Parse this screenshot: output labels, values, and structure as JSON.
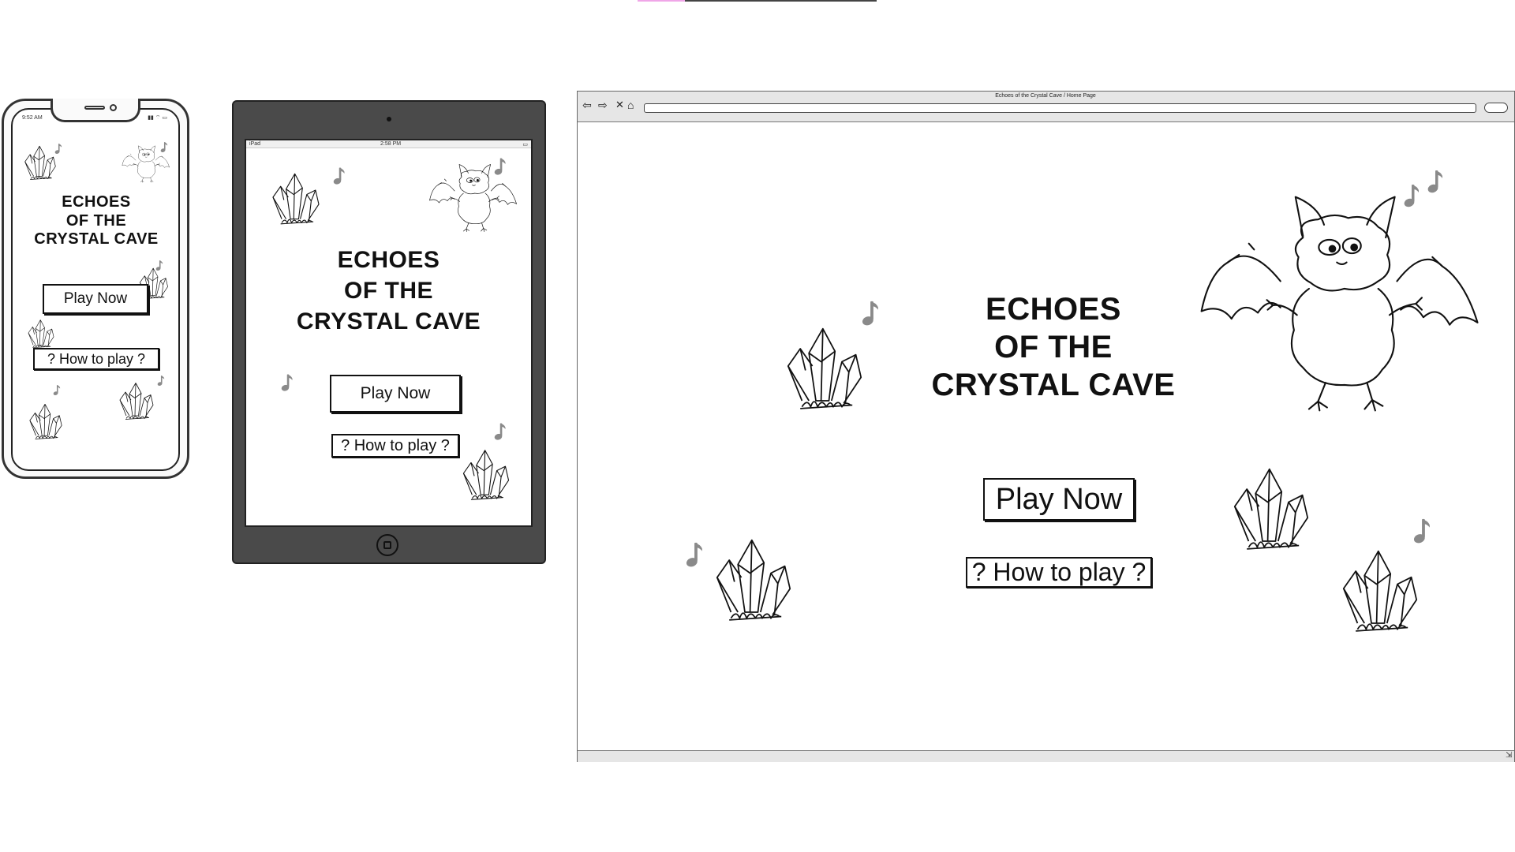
{
  "phone": {
    "status_time": "9:52 AM",
    "title_lines": [
      "ECHOES",
      "OF THE",
      "CRYSTAL CAVE"
    ],
    "play_label": "Play Now",
    "help_label": "? How to play ?"
  },
  "tablet": {
    "status_carrier": "iPad",
    "status_time": "2:58 PM",
    "title_lines": [
      "ECHOES",
      "OF THE",
      "CRYSTAL CAVE"
    ],
    "play_label": "Play Now",
    "help_label": "? How to play ?"
  },
  "browser": {
    "window_title": "Echoes of the Crystal Cave / Home Page",
    "title_lines": [
      "ECHOES",
      "OF THE",
      "CRYSTAL CAVE"
    ],
    "play_label": "Play Now",
    "help_label": "? How to play ?"
  },
  "icons": [
    "crystal-icon",
    "bat-icon",
    "music-note-icon",
    "back-arrow-icon",
    "forward-arrow-icon",
    "close-icon",
    "home-icon"
  ],
  "colors": {
    "ink": "#111111",
    "note_gray": "#8a8a8a",
    "device_dark": "#4a4a4a",
    "accent_pink": "#f0a6e8"
  }
}
